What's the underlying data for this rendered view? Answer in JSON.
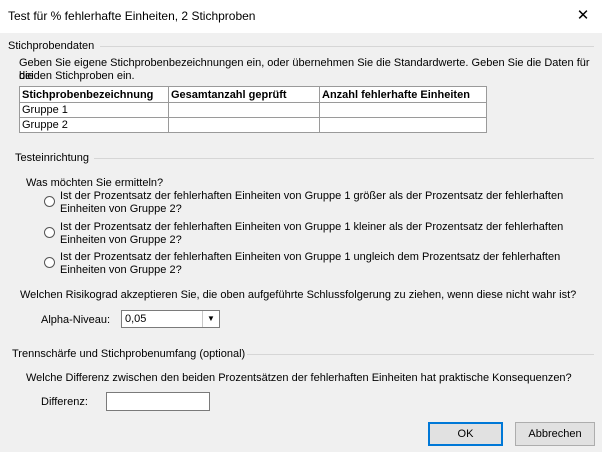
{
  "window": {
    "title": "Test für % fehlerhafte Einheiten, 2 Stichproben"
  },
  "sample_data": {
    "section_label": "Stichprobendaten",
    "instructions_line1": "Geben Sie eigene Stichprobenbezeichnungen ein, oder übernehmen Sie die Standardwerte. Geben Sie die Daten für die",
    "instructions_line2": "beiden Stichproben ein.",
    "columns": [
      "Stichprobenbezeichnung",
      "Gesamtanzahl geprüft",
      "Anzahl fehlerhafte Einheiten"
    ],
    "rows": [
      {
        "name": "Gruppe 1",
        "total": "",
        "defective": ""
      },
      {
        "name": "Gruppe 2",
        "total": "",
        "defective": ""
      }
    ]
  },
  "test_setup": {
    "section_label": "Testeinrichtung",
    "question": "Was möchten Sie ermitteln?",
    "options": [
      {
        "line1": "Ist der Prozentsatz der fehlerhaften Einheiten von Gruppe 1 größer als der Prozentsatz der fehlerhaften",
        "line2": "Einheiten von Gruppe 2?"
      },
      {
        "line1": "Ist der Prozentsatz der fehlerhaften Einheiten von Gruppe 1 kleiner als der Prozentsatz der fehlerhaften",
        "line2": "Einheiten von Gruppe 2?"
      },
      {
        "line1": "Ist der Prozentsatz der fehlerhaften Einheiten von Gruppe 1 ungleich dem Prozentsatz der fehlerhaften",
        "line2": "Einheiten von Gruppe 2?"
      }
    ],
    "risk_question": "Welchen Risikograd akzeptieren Sie, die oben aufgeführte Schlussfolgerung zu ziehen, wenn diese nicht wahr ist?",
    "alpha_label": "Alpha-Niveau:",
    "alpha_value": "0,05"
  },
  "power": {
    "section_label": "Trennschärfe und Stichprobenumfang (optional)",
    "question": "Welche Differenz zwischen den beiden Prozentsätzen der fehlerhaften Einheiten hat praktische Konsequenzen?",
    "difference_label": "Differenz:",
    "difference_value": ""
  },
  "buttons": {
    "ok": "OK",
    "cancel": "Abbrechen"
  },
  "icons": {
    "close": "close-icon",
    "dropdown": "chevron-down-icon"
  }
}
